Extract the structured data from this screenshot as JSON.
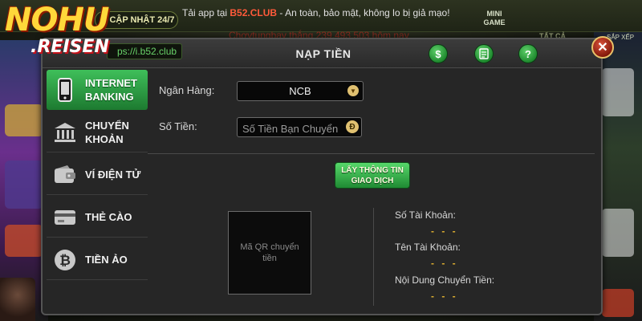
{
  "logo": {
    "line1": "NOHU",
    "line2": ".REISEN"
  },
  "topbar": {
    "update_label": "CẬP NHẬT 24/7",
    "notice_prefix": "Tải app tại ",
    "notice_brand": "B52.CLUB",
    "notice_suffix": " - An toàn, bảo mật, không lo bị giả mạo!",
    "ticker": "Chơvtungbay thắng 239.493.503 hôm nay",
    "mini_game": "MINI GAME",
    "tat_ca": "TẤT CẢ",
    "sap_xep": "SẮP XẾP"
  },
  "dialog": {
    "title": "NẠP TIỀN",
    "url": "ps://i.b52.club",
    "header_icons": [
      "dollar-icon",
      "list-icon",
      "help-icon"
    ],
    "close_icon": "close-icon"
  },
  "sidebar": {
    "items": [
      {
        "label_1": "INTERNET",
        "label_2": "BANKING",
        "icon": "phone-icon",
        "active": true
      },
      {
        "label_1": "CHUYỂN",
        "label_2": "KHOẢN",
        "icon": "bank-icon",
        "active": false
      },
      {
        "label_1": "VÍ ĐIỆN TỬ",
        "label_2": "",
        "icon": "wallet-icon",
        "active": false
      },
      {
        "label_1": "THẺ CÀO",
        "label_2": "",
        "icon": "card-icon",
        "active": false
      },
      {
        "label_1": "TIỀN ẢO",
        "label_2": "",
        "icon": "bitcoin-icon",
        "active": false
      }
    ]
  },
  "form": {
    "bank_label": "Ngân Hàng:",
    "bank_value": "NCB",
    "amount_label": "Số Tiền:",
    "amount_placeholder": "Số Tiền Bạn Chuyển",
    "currency": "Đ",
    "get_info_line1": "LẤY THÔNG TIN",
    "get_info_line2": "GIAO DỊCH"
  },
  "qr": {
    "text": "Mã QR chuyển tiền"
  },
  "details": {
    "account_no_label": "Số Tài Khoản:",
    "account_no_value": "- - -",
    "account_name_label": "Tên Tài Khoản:",
    "account_name_value": "- - -",
    "content_label": "Nội Dung Chuyển Tiền:",
    "content_value": "- - -"
  },
  "colors": {
    "accent_green": "#2fa844",
    "gold": "#e0b030",
    "close_red": "#b02a14"
  }
}
